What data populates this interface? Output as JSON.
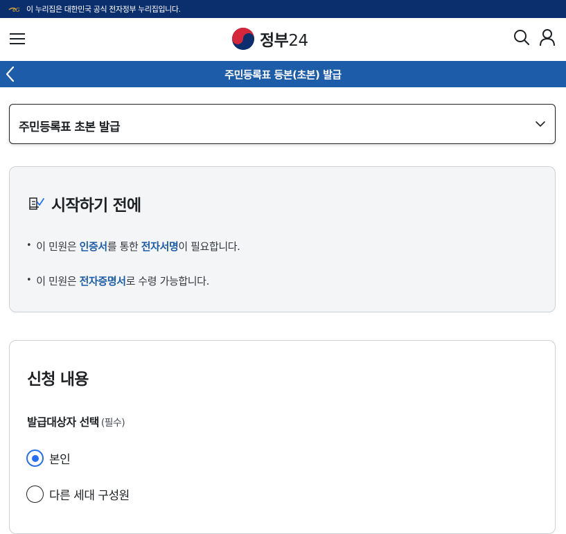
{
  "banner": {
    "text": "이 누리집은 대한민국 공식 전자정부 누리집입니다.",
    "eg_logo_text": "eG"
  },
  "header": {
    "logo_text_prefix": "정부",
    "logo_text_suffix": "24",
    "icons": [
      "menu-icon",
      "search-icon",
      "user-icon"
    ]
  },
  "title_bar": {
    "title": "주민등록표 등본(초본) 발급",
    "back_icon": "chevron-left-icon"
  },
  "service_select": {
    "selected": "주민등록표 초본 발급"
  },
  "notice": {
    "heading": "시작하기 전에",
    "items": [
      {
        "pre": "이 민원은 ",
        "highlight": "인증서",
        "post": "를 통한 ",
        "highlight2": "전자서명",
        "post2": "이 필요합니다."
      },
      {
        "pre": "이 민원은 ",
        "highlight": "전자증명서",
        "post": "로 수령 가능합니다."
      }
    ]
  },
  "application": {
    "heading": "신청 내용",
    "field_label": "발급대상자 선택",
    "field_required": "(필수)",
    "options": [
      {
        "label": "본인",
        "checked": true
      },
      {
        "label": "다른 세대 구성원",
        "checked": false
      }
    ]
  },
  "colors": {
    "banner_bg": "#0b2e6c",
    "title_bar_bg": "#1d5ca8",
    "highlight": "#1d5ca8",
    "radio_checked": "#256ef4"
  }
}
